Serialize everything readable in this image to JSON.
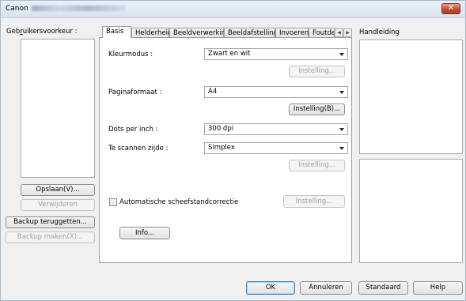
{
  "window": {
    "title": "Canon",
    "close_label": "✕"
  },
  "left": {
    "presets_label_pre": "Geb",
    "presets_label_u": "r",
    "presets_label_post": "uikersvoorkeur :",
    "save_button": "Opslaan(V)...",
    "delete_button": "Verwijderen",
    "restore_backup_button": "Backup teruggetten...",
    "make_backup_button": "Backup maken(X)..."
  },
  "tabs": [
    "Basis",
    "Helderheid",
    "Beeldverwerking",
    "Beeldafstelling",
    "Invoeren",
    "Foutde"
  ],
  "basic": {
    "color_mode_label": "Kleurmodus :",
    "color_mode_value": "Zwart en wit",
    "settings_button_1": "Instelling...",
    "page_size_label": "Paginaformaat :",
    "page_size_value": "A4",
    "settings_button_2": "Instelling(B)...",
    "dpi_label": "Dots per inch :",
    "dpi_value": "300 dpi",
    "scan_side_label": "Te scannen zijde :",
    "scan_side_value": "Simplex",
    "settings_button_3": "Instelling...",
    "deskew_label": "Automatische scheefstandcorrectie",
    "settings_button_4": "Instelling...",
    "info_button": "Info..."
  },
  "right": {
    "manual_label": "Handleiding"
  },
  "footer": {
    "ok": "OK",
    "cancel": "Annuleren",
    "default": "Standaard",
    "help": "Help"
  },
  "colors": {
    "title_bar": "#dbe6f3",
    "close_button": "#c24b2f",
    "window_bg": "#f0f0f0",
    "default_button_border": "#3c7fb1"
  }
}
